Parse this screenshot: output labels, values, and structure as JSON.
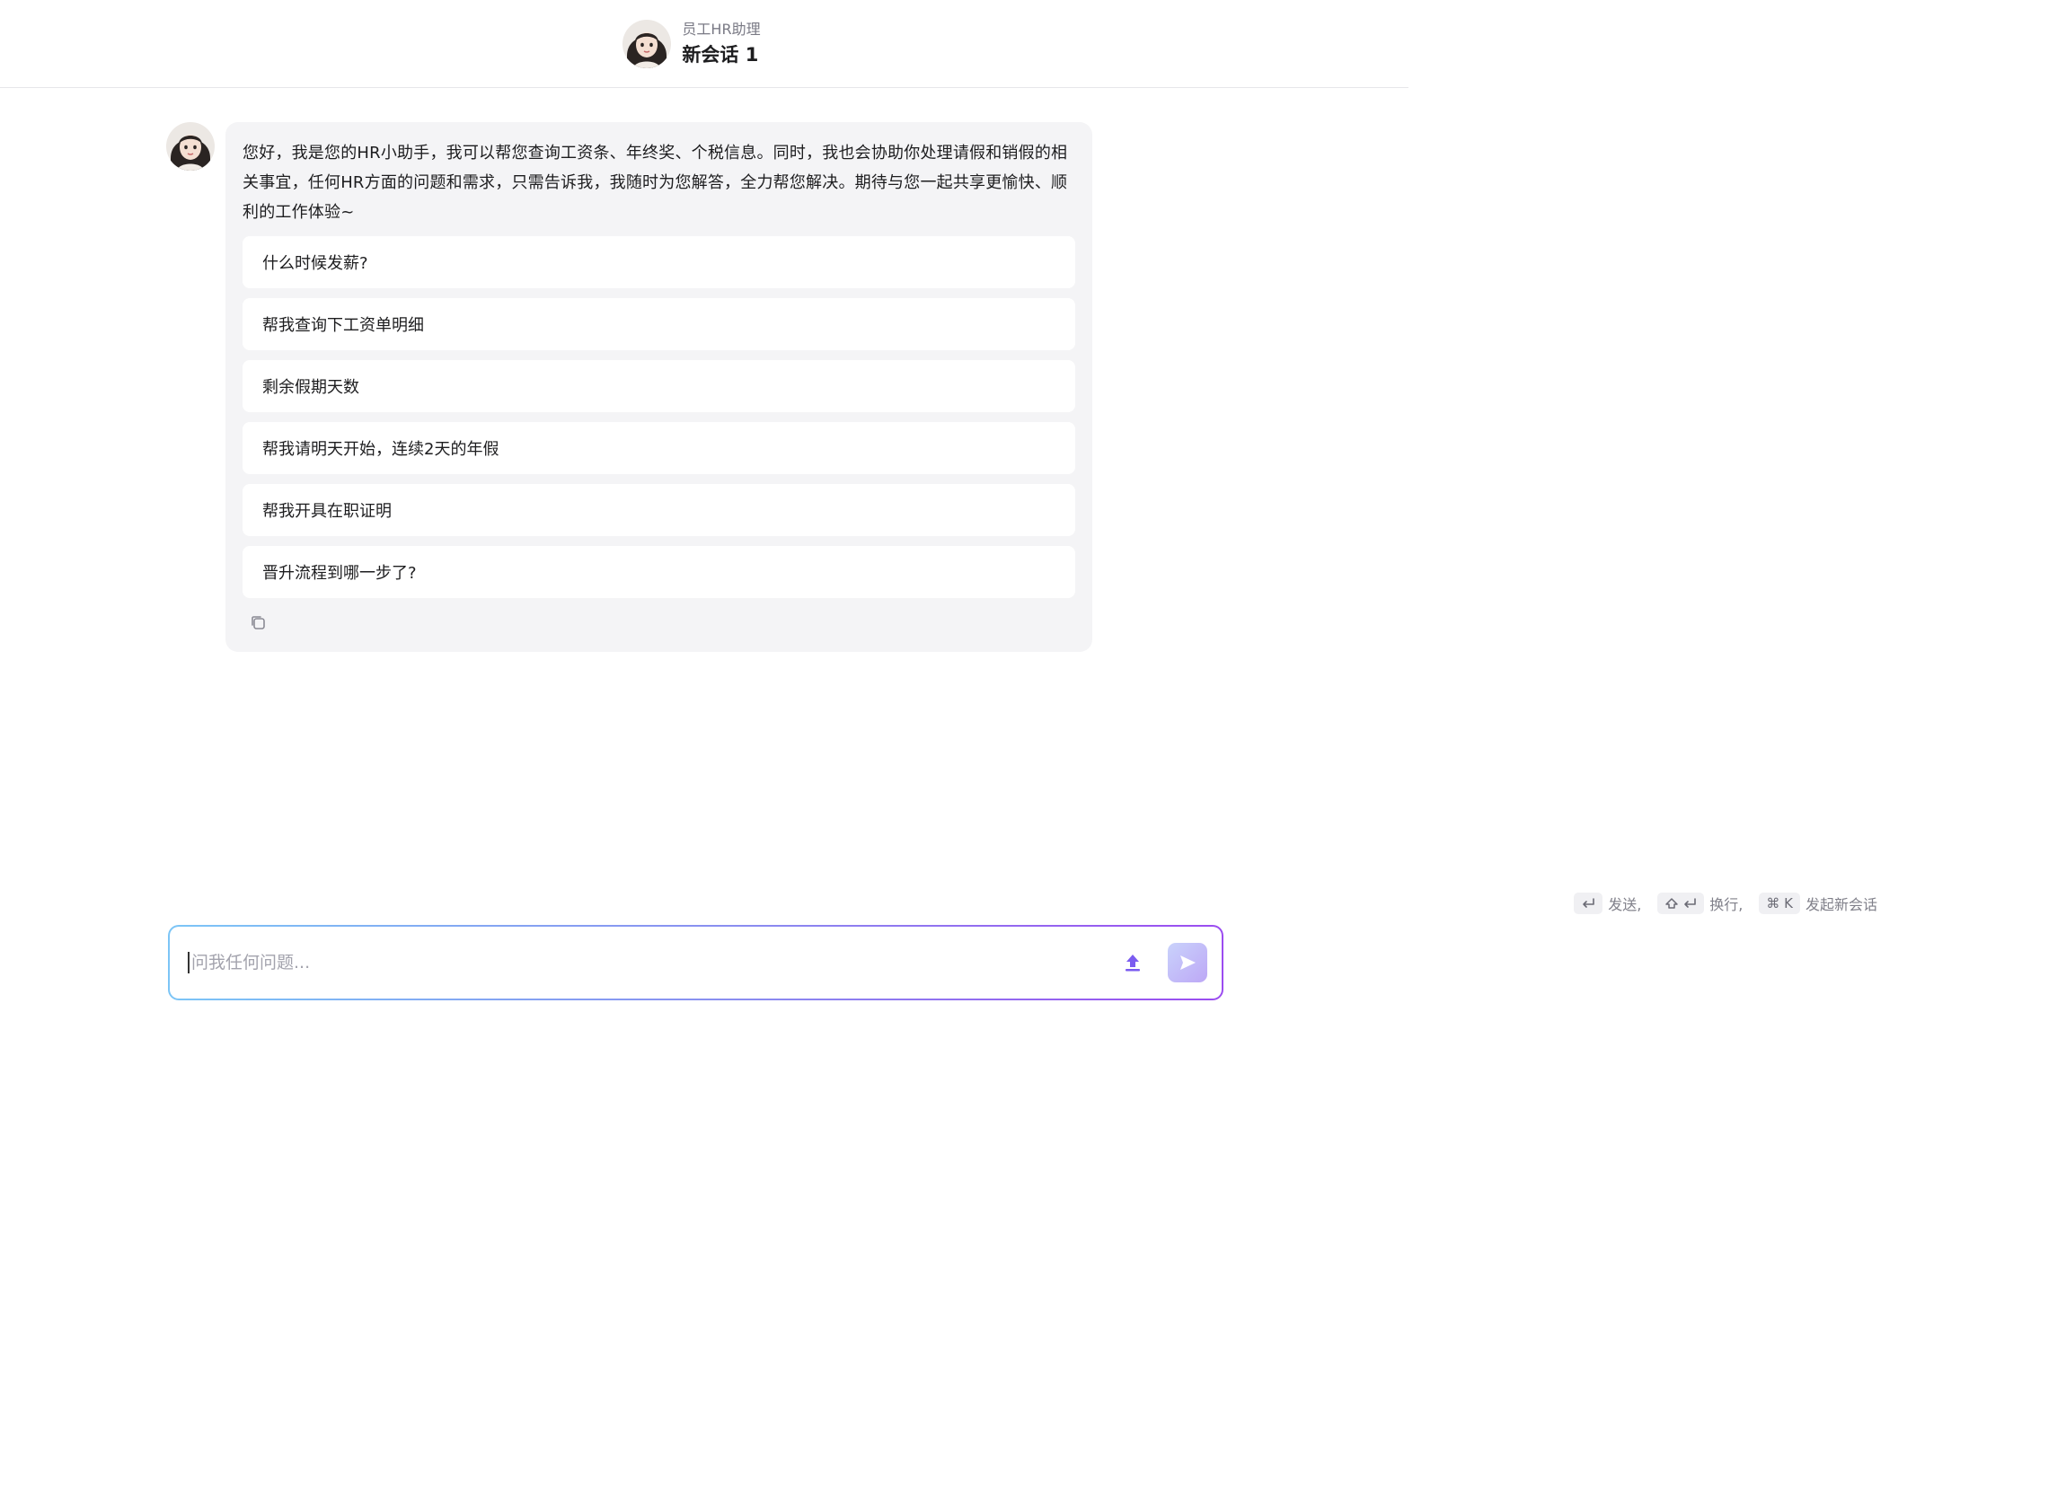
{
  "header": {
    "subtitle": "员工HR助理",
    "title": "新会话 1",
    "avatar_icon": "assistant-avatar-icon"
  },
  "message": {
    "text": "您好，我是您的HR小助手，我可以帮您查询工资条、年终奖、个税信息。同时，我也会协助你处理请假和销假的相关事宜，任何HR方面的问题和需求，只需告诉我，我随时为您解答，全力帮您解决。期待与您一起共享更愉快、顺利的工作体验~",
    "suggestions": [
      "什么时候发薪?",
      "帮我查询下工资单明细",
      "剩余假期天数",
      "帮我请明天开始，连续2天的年假",
      "帮我开具在职证明",
      "晋升流程到哪一步了?"
    ],
    "copy_icon": "copy-icon"
  },
  "hints": {
    "send": "发送,",
    "newline": "换行,",
    "new_chat_key": "⌘ K",
    "new_chat": "发起新会话"
  },
  "input": {
    "placeholder": "问我任何问题...",
    "value": ""
  },
  "colors": {
    "accent": "#7b5cf0",
    "bubble_bg": "#f4f4f6",
    "border_gradient_start": "#7cc5f6",
    "border_gradient_end": "#9b4cf0"
  }
}
